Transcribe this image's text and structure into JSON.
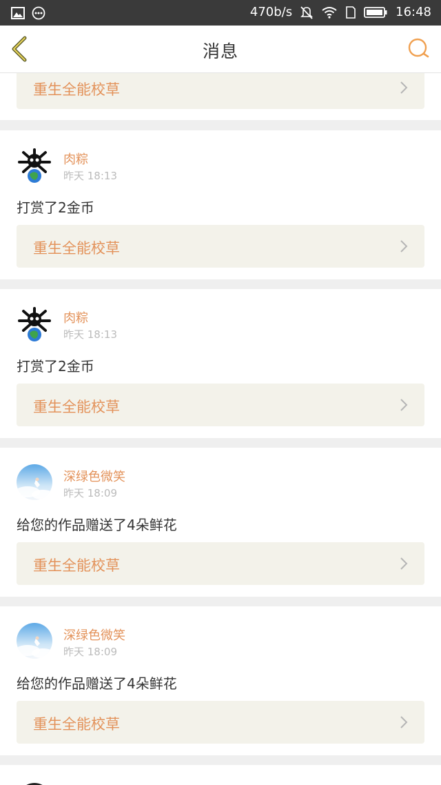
{
  "status_bar": {
    "speed": "470b/s",
    "time": "16:48",
    "icons": [
      "image-icon",
      "more-icon",
      "mute-icon",
      "wifi-icon",
      "sim-icon",
      "battery-icon"
    ]
  },
  "nav": {
    "title": "消息",
    "back_icon": "back-chevron-icon",
    "search_icon": "search-icon"
  },
  "colors": {
    "accent": "#e3925a",
    "link_bg": "#f3f2ea",
    "status_bg": "#3a3a3a"
  },
  "top_partial": {
    "work_title": "重生全能校草"
  },
  "messages": [
    {
      "avatar": "skull-globe-avatar",
      "username": "肉粽",
      "time": "昨天 18:13",
      "text": "打赏了2金币",
      "work_title": "重生全能校草"
    },
    {
      "avatar": "skull-globe-avatar",
      "username": "肉粽",
      "time": "昨天 18:13",
      "text": "打赏了2金币",
      "work_title": "重生全能校草"
    },
    {
      "avatar": "sky-photo-avatar",
      "username": "深绿色微笑",
      "time": "昨天 18:09",
      "text": "给您的作品赠送了4朵鲜花",
      "work_title": "重生全能校草"
    },
    {
      "avatar": "sky-photo-avatar",
      "username": "深绿色微笑",
      "time": "昨天 18:09",
      "text": "给您的作品赠送了4朵鲜花",
      "work_title": "重生全能校草"
    }
  ]
}
